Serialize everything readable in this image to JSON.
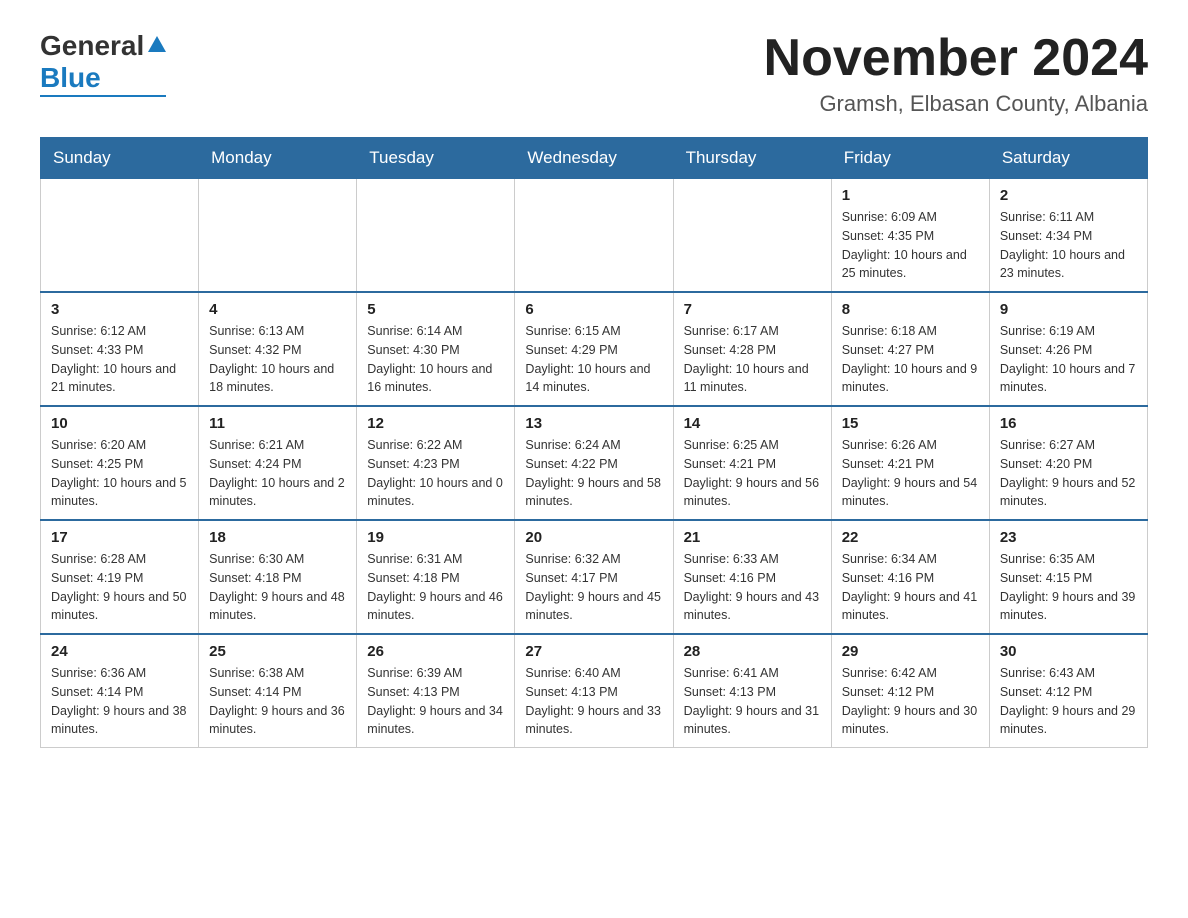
{
  "header": {
    "logo": {
      "general": "General",
      "blue": "Blue",
      "tagline": ""
    },
    "title": "November 2024",
    "subtitle": "Gramsh, Elbasan County, Albania"
  },
  "days_of_week": [
    "Sunday",
    "Monday",
    "Tuesday",
    "Wednesday",
    "Thursday",
    "Friday",
    "Saturday"
  ],
  "weeks": [
    [
      {
        "day": "",
        "sunrise": "",
        "sunset": "",
        "daylight": ""
      },
      {
        "day": "",
        "sunrise": "",
        "sunset": "",
        "daylight": ""
      },
      {
        "day": "",
        "sunrise": "",
        "sunset": "",
        "daylight": ""
      },
      {
        "day": "",
        "sunrise": "",
        "sunset": "",
        "daylight": ""
      },
      {
        "day": "",
        "sunrise": "",
        "sunset": "",
        "daylight": ""
      },
      {
        "day": "1",
        "sunrise": "Sunrise: 6:09 AM",
        "sunset": "Sunset: 4:35 PM",
        "daylight": "Daylight: 10 hours and 25 minutes."
      },
      {
        "day": "2",
        "sunrise": "Sunrise: 6:11 AM",
        "sunset": "Sunset: 4:34 PM",
        "daylight": "Daylight: 10 hours and 23 minutes."
      }
    ],
    [
      {
        "day": "3",
        "sunrise": "Sunrise: 6:12 AM",
        "sunset": "Sunset: 4:33 PM",
        "daylight": "Daylight: 10 hours and 21 minutes."
      },
      {
        "day": "4",
        "sunrise": "Sunrise: 6:13 AM",
        "sunset": "Sunset: 4:32 PM",
        "daylight": "Daylight: 10 hours and 18 minutes."
      },
      {
        "day": "5",
        "sunrise": "Sunrise: 6:14 AM",
        "sunset": "Sunset: 4:30 PM",
        "daylight": "Daylight: 10 hours and 16 minutes."
      },
      {
        "day": "6",
        "sunrise": "Sunrise: 6:15 AM",
        "sunset": "Sunset: 4:29 PM",
        "daylight": "Daylight: 10 hours and 14 minutes."
      },
      {
        "day": "7",
        "sunrise": "Sunrise: 6:17 AM",
        "sunset": "Sunset: 4:28 PM",
        "daylight": "Daylight: 10 hours and 11 minutes."
      },
      {
        "day": "8",
        "sunrise": "Sunrise: 6:18 AM",
        "sunset": "Sunset: 4:27 PM",
        "daylight": "Daylight: 10 hours and 9 minutes."
      },
      {
        "day": "9",
        "sunrise": "Sunrise: 6:19 AM",
        "sunset": "Sunset: 4:26 PM",
        "daylight": "Daylight: 10 hours and 7 minutes."
      }
    ],
    [
      {
        "day": "10",
        "sunrise": "Sunrise: 6:20 AM",
        "sunset": "Sunset: 4:25 PM",
        "daylight": "Daylight: 10 hours and 5 minutes."
      },
      {
        "day": "11",
        "sunrise": "Sunrise: 6:21 AM",
        "sunset": "Sunset: 4:24 PM",
        "daylight": "Daylight: 10 hours and 2 minutes."
      },
      {
        "day": "12",
        "sunrise": "Sunrise: 6:22 AM",
        "sunset": "Sunset: 4:23 PM",
        "daylight": "Daylight: 10 hours and 0 minutes."
      },
      {
        "day": "13",
        "sunrise": "Sunrise: 6:24 AM",
        "sunset": "Sunset: 4:22 PM",
        "daylight": "Daylight: 9 hours and 58 minutes."
      },
      {
        "day": "14",
        "sunrise": "Sunrise: 6:25 AM",
        "sunset": "Sunset: 4:21 PM",
        "daylight": "Daylight: 9 hours and 56 minutes."
      },
      {
        "day": "15",
        "sunrise": "Sunrise: 6:26 AM",
        "sunset": "Sunset: 4:21 PM",
        "daylight": "Daylight: 9 hours and 54 minutes."
      },
      {
        "day": "16",
        "sunrise": "Sunrise: 6:27 AM",
        "sunset": "Sunset: 4:20 PM",
        "daylight": "Daylight: 9 hours and 52 minutes."
      }
    ],
    [
      {
        "day": "17",
        "sunrise": "Sunrise: 6:28 AM",
        "sunset": "Sunset: 4:19 PM",
        "daylight": "Daylight: 9 hours and 50 minutes."
      },
      {
        "day": "18",
        "sunrise": "Sunrise: 6:30 AM",
        "sunset": "Sunset: 4:18 PM",
        "daylight": "Daylight: 9 hours and 48 minutes."
      },
      {
        "day": "19",
        "sunrise": "Sunrise: 6:31 AM",
        "sunset": "Sunset: 4:18 PM",
        "daylight": "Daylight: 9 hours and 46 minutes."
      },
      {
        "day": "20",
        "sunrise": "Sunrise: 6:32 AM",
        "sunset": "Sunset: 4:17 PM",
        "daylight": "Daylight: 9 hours and 45 minutes."
      },
      {
        "day": "21",
        "sunrise": "Sunrise: 6:33 AM",
        "sunset": "Sunset: 4:16 PM",
        "daylight": "Daylight: 9 hours and 43 minutes."
      },
      {
        "day": "22",
        "sunrise": "Sunrise: 6:34 AM",
        "sunset": "Sunset: 4:16 PM",
        "daylight": "Daylight: 9 hours and 41 minutes."
      },
      {
        "day": "23",
        "sunrise": "Sunrise: 6:35 AM",
        "sunset": "Sunset: 4:15 PM",
        "daylight": "Daylight: 9 hours and 39 minutes."
      }
    ],
    [
      {
        "day": "24",
        "sunrise": "Sunrise: 6:36 AM",
        "sunset": "Sunset: 4:14 PM",
        "daylight": "Daylight: 9 hours and 38 minutes."
      },
      {
        "day": "25",
        "sunrise": "Sunrise: 6:38 AM",
        "sunset": "Sunset: 4:14 PM",
        "daylight": "Daylight: 9 hours and 36 minutes."
      },
      {
        "day": "26",
        "sunrise": "Sunrise: 6:39 AM",
        "sunset": "Sunset: 4:13 PM",
        "daylight": "Daylight: 9 hours and 34 minutes."
      },
      {
        "day": "27",
        "sunrise": "Sunrise: 6:40 AM",
        "sunset": "Sunset: 4:13 PM",
        "daylight": "Daylight: 9 hours and 33 minutes."
      },
      {
        "day": "28",
        "sunrise": "Sunrise: 6:41 AM",
        "sunset": "Sunset: 4:13 PM",
        "daylight": "Daylight: 9 hours and 31 minutes."
      },
      {
        "day": "29",
        "sunrise": "Sunrise: 6:42 AM",
        "sunset": "Sunset: 4:12 PM",
        "daylight": "Daylight: 9 hours and 30 minutes."
      },
      {
        "day": "30",
        "sunrise": "Sunrise: 6:43 AM",
        "sunset": "Sunset: 4:12 PM",
        "daylight": "Daylight: 9 hours and 29 minutes."
      }
    ]
  ]
}
